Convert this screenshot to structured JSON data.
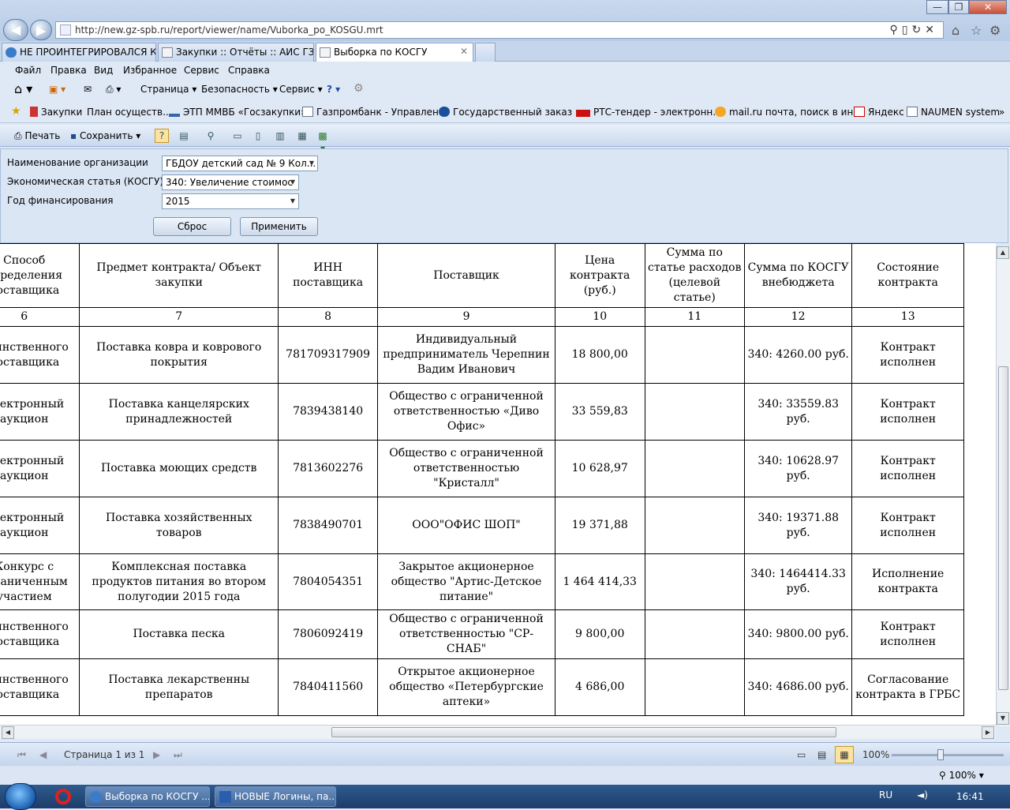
{
  "browser": {
    "url": "http://new.gz-spb.ru/report/viewer/name/Vuborka_po_KOSGU.mrt"
  },
  "tabs": [
    {
      "label": "НЕ ПРОИНТЕГРИРОВАЛСЯ К..."
    },
    {
      "label": "Закупки :: Отчёты :: АИС ГЗ"
    },
    {
      "label": "Выборка по КОСГУ"
    }
  ],
  "menu": [
    "Файл",
    "Правка",
    "Вид",
    "Избранное",
    "Сервис",
    "Справка"
  ],
  "commands": {
    "page": "Страница",
    "security": "Безопасность",
    "service": "Сервис"
  },
  "favorites": [
    "Закупки",
    "План осуществ...",
    "ЭТП ММВБ «Госзакупки»",
    "Газпромбанк - Управлен...",
    "Государственный заказ ...",
    "РТС-тендер - электронн...",
    "mail.ru почта, поиск в ин...",
    "Яндекс",
    "NAUMEN system"
  ],
  "report_toolbar": {
    "print": "Печать",
    "save": "Сохранить"
  },
  "params": {
    "org_label": "Наименование организации",
    "org_value": "ГБДОУ детский сад № 9 Кол...",
    "kosgu_label": "Экономическая статья (КОСГУ)",
    "kosgu_value": "340: Увеличение стоимос",
    "year_label": "Год финансирования",
    "year_value": "2015",
    "reset": "Сброс",
    "apply": "Применить"
  },
  "table": {
    "headers": [
      "Способ определения поставщика",
      "Предмет контракта/ Объект закупки",
      "ИНН поставщика",
      "Поставщик",
      "Цена контракта (руб.)",
      "Сумма по статье расходов (целевой статье)",
      "Сумма по КОСГУ внебюджета",
      "Состояние контракта"
    ],
    "numbers": [
      "6",
      "7",
      "8",
      "9",
      "10",
      "11",
      "12",
      "13"
    ],
    "rows": [
      {
        "method": "Единственного поставщика",
        "subject": "Поставка ковра и коврового покрытия",
        "inn": "781709317909",
        "supplier": "Индивидуальный предприниматель Черепнин Вадим Иванович",
        "price": "18 800,00",
        "target": "",
        "kosgu": "340: 4260.00 руб.",
        "state": "Контракт исполнен"
      },
      {
        "method": "Электронный аукцион",
        "subject": "Поставка канцелярских принадлежностей",
        "inn": "7839438140",
        "supplier": "Общество  с ограниченной ответственностью «Диво Офис»",
        "price": "33 559,83",
        "target": "",
        "kosgu": "340: 33559.83 руб.",
        "state": "Контракт исполнен"
      },
      {
        "method": "Электронный аукцион",
        "subject": "Поставка моющих средств",
        "inn": "7813602276",
        "supplier": "Общество с ограниченной ответственностью \"Кристалл\"",
        "price": "10 628,97",
        "target": "",
        "kosgu": "340: 10628.97 руб.",
        "state": "Контракт исполнен"
      },
      {
        "method": "Электронный аукцион",
        "subject": "Поставка хозяйственных товаров",
        "inn": "7838490701",
        "supplier": "ООО\"ОФИС ШОП\"",
        "price": "19 371,88",
        "target": "",
        "kosgu": "340: 19371.88 руб.",
        "state": "Контракт исполнен"
      },
      {
        "method": "Конкурс с ограниченным участием",
        "subject": "Комплексная поставка продуктов питания во втором полугодии 2015 года",
        "inn": "7804054351",
        "supplier": "Закрытое акционерное общество \"Артис-Детское питание\"",
        "price": "1 464 414,33",
        "target": "",
        "kosgu": "340: 1464414.33 руб.",
        "state": "Исполнение контракта"
      },
      {
        "method": "Единственного поставщика",
        "subject": "Поставка песка",
        "inn": "7806092419",
        "supplier": "Общество с ограниченной ответственностью \"СР-СНАБ\"",
        "price": "9 800,00",
        "target": "",
        "kosgu": "340: 9800.00 руб.",
        "state": "Контракт исполнен"
      },
      {
        "method": "Единственного поставщика",
        "subject": "Поставка лекарственны препаратов",
        "inn": "7840411560",
        "supplier": "Открытое акционерное общество «Петербургские аптеки»",
        "price": "4 686,00",
        "target": "",
        "kosgu": "340: 4686.00 руб.",
        "state": "Согласование контракта в ГРБС"
      }
    ]
  },
  "pager": {
    "page_text": "Страница 1 из 1",
    "zoom": "100%"
  },
  "status": {
    "zoom": "100%"
  },
  "taskbar": {
    "task1": "Выборка по КОСГУ ...",
    "task2": "НОВЫЕ Логины, па...",
    "lang": "RU",
    "time": "16:41"
  }
}
